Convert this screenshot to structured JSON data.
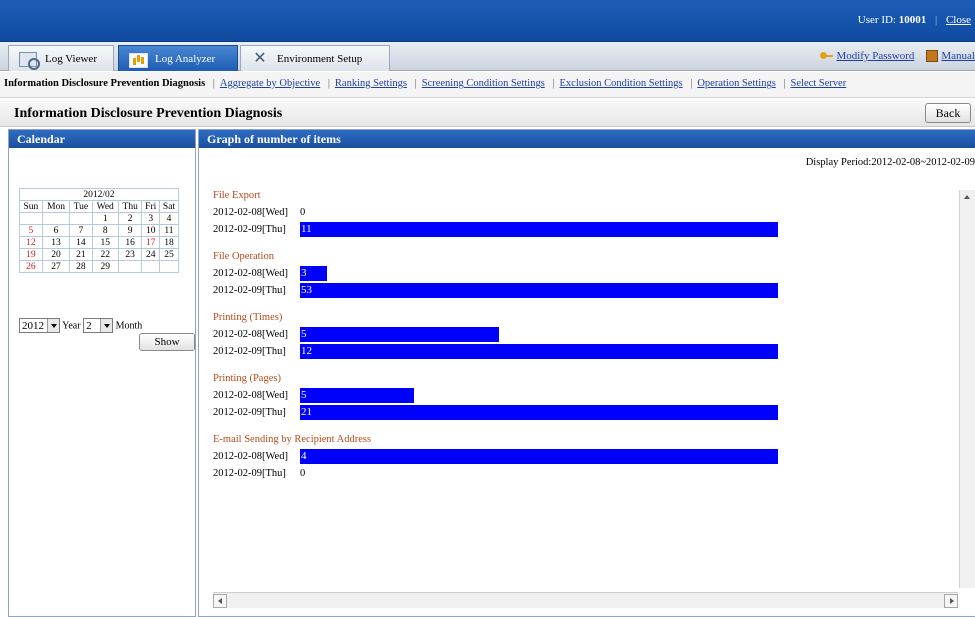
{
  "header": {
    "user_label": "User ID:",
    "user_id": "10001",
    "close_label": "Close"
  },
  "tabs": [
    {
      "label": "Log Viewer",
      "icon": "log-viewer-icon"
    },
    {
      "label": "Log Analyzer",
      "icon": "log-analyzer-icon",
      "active": true
    },
    {
      "label": "Environment Setup",
      "icon": "tools-icon"
    }
  ],
  "top_links": {
    "modify_password": "Modify Password",
    "manual": "Manual"
  },
  "subnav": {
    "current": "Information Disclosure Prevention Diagnosis",
    "links": [
      "Aggregate by Objective",
      "Ranking Settings",
      "Screening Condition Settings",
      "Exclusion Condition Settings",
      "Operation Settings",
      "Select Server"
    ]
  },
  "page": {
    "title": "Information Disclosure Prevention Diagnosis",
    "back_label": "Back"
  },
  "calendar": {
    "panel_title": "Calendar",
    "month_label": "2012/02",
    "weekdays": [
      "Sun",
      "Mon",
      "Tue",
      "Wed",
      "Thu",
      "Fri",
      "Sat"
    ],
    "weeks": [
      [
        "",
        "",
        "",
        "1",
        "2",
        "3",
        "4"
      ],
      [
        "5",
        "6",
        "7",
        "8",
        "9",
        "10",
        "11"
      ],
      [
        "12",
        "13",
        "14",
        "15",
        "16",
        "17",
        "18"
      ],
      [
        "19",
        "20",
        "21",
        "22",
        "23",
        "24",
        "25"
      ],
      [
        "26",
        "27",
        "28",
        "29",
        "",
        "",
        ""
      ]
    ],
    "year_value": "2012",
    "year_label": "Year",
    "month_value": "2",
    "month_label_text": "Month",
    "show_label": "Show"
  },
  "graph": {
    "panel_title": "Graph of number of items",
    "period": "Display Period:2012-02-08~2012-02-09"
  },
  "chart_data": {
    "type": "bar",
    "orientation": "horizontal",
    "bar_color": "#0000ff",
    "groups": [
      {
        "title": "File Export",
        "rows": [
          {
            "date": "2012-02-08[Wed]",
            "value": 0
          },
          {
            "date": "2012-02-09[Thu]",
            "value": 11
          }
        ]
      },
      {
        "title": "File Operation",
        "rows": [
          {
            "date": "2012-02-08[Wed]",
            "value": 3
          },
          {
            "date": "2012-02-09[Thu]",
            "value": 53
          }
        ]
      },
      {
        "title": "Printing (Times)",
        "rows": [
          {
            "date": "2012-02-08[Wed]",
            "value": 5
          },
          {
            "date": "2012-02-09[Thu]",
            "value": 12
          }
        ]
      },
      {
        "title": "Printing (Pages)",
        "rows": [
          {
            "date": "2012-02-08[Wed]",
            "value": 5
          },
          {
            "date": "2012-02-09[Thu]",
            "value": 21
          }
        ]
      },
      {
        "title": "E-mail Sending by Recipient Address",
        "rows": [
          {
            "date": "2012-02-08[Wed]",
            "value": 4
          },
          {
            "date": "2012-02-09[Thu]",
            "value": 0
          }
        ]
      }
    ]
  }
}
